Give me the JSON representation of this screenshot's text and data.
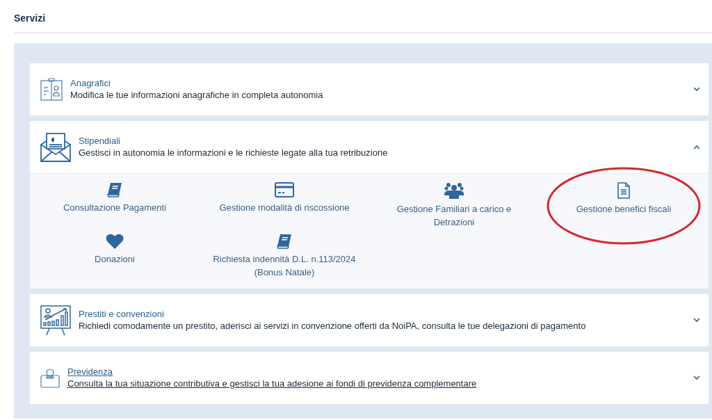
{
  "page_title": "Servizi",
  "sections": [
    {
      "kind": "id-card",
      "title": "Anagrafici",
      "description": "Modifica le tue informazioni anagrafiche in completa autonomia",
      "expanded": false,
      "hovered": false
    },
    {
      "kind": "envelope",
      "title": "Stipendiali",
      "description": "Gestisci in autonomia le informazioni e le richieste legate alla tua retribuzione",
      "expanded": true,
      "hovered": false,
      "items": [
        {
          "kind": "book",
          "label": "Consultazione Pagamenti",
          "highlighted": false
        },
        {
          "kind": "card",
          "label": "Gestione modalità di riscossione",
          "highlighted": false
        },
        {
          "kind": "people",
          "label": "Gestione Familiari a carico e Detrazioni",
          "highlighted": false
        },
        {
          "kind": "document",
          "label": "Gestione benefici fiscali",
          "highlighted": true
        },
        {
          "kind": "heart",
          "label": "Donazioni",
          "highlighted": false
        },
        {
          "kind": "book",
          "label": "Richiesta indennità D.L. n.113/2024 (Bonus Natale)",
          "highlighted": false
        }
      ]
    },
    {
      "kind": "chart",
      "title": "Prestiti e convenzioni",
      "description": "Richiedi comodamente un prestito, aderisci ai servizi in convenzione offerti da NoiPA, consulta le tue delegazioni di pagamento",
      "expanded": false,
      "hovered": false
    },
    {
      "kind": "coin",
      "title": "Previdenza",
      "description": "Consulta la tua situazione contributiva e gestisci la tua adesione ai fondi di previdenza complementare",
      "expanded": false,
      "hovered": true
    }
  ]
}
